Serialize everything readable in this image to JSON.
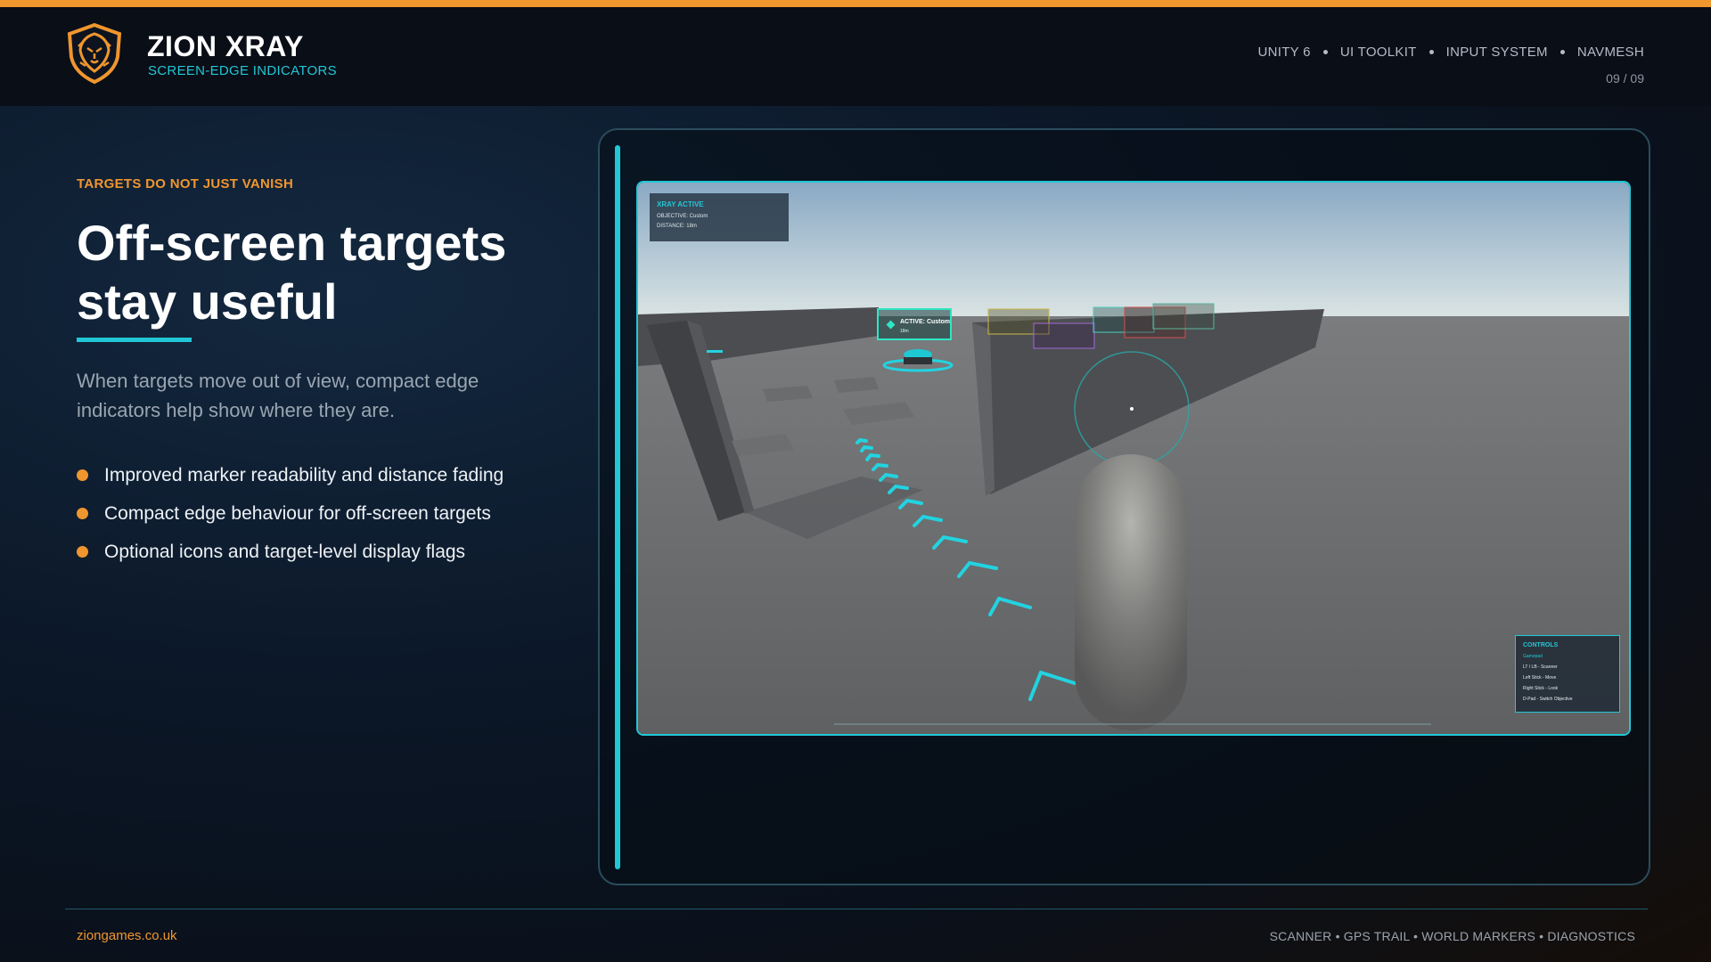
{
  "header": {
    "brand_title": "ZION XRAY",
    "brand_subtitle": "SCREEN-EDGE INDICATORS",
    "tech_tags": [
      "UNITY 6",
      "UI TOOLKIT",
      "INPUT SYSTEM",
      "NAVMESH"
    ],
    "page_number": "09 / 09",
    "logo_icon": "lion-shield-icon"
  },
  "content": {
    "eyebrow": "TARGETS DO NOT JUST VANISH",
    "headline_line1": "Off-screen targets",
    "headline_line2": "stay useful",
    "lead": "When targets move out of view, compact edge indicators help show where they are.",
    "bullets": [
      "Improved marker readability and distance fading",
      "Compact edge behaviour for off-screen targets",
      "Optional icons and target-level display flags"
    ]
  },
  "game": {
    "hud": {
      "title": "XRAY ACTIVE",
      "objective": "OBJECTIVE: Custom",
      "distance": "DISTANCE: 18m"
    },
    "active_marker": {
      "label": "ACTIVE: Custom",
      "distance": "18m"
    },
    "controls": {
      "title": "CONTROLS",
      "subtitle": "Gamepad",
      "lines": [
        "LT / LB - Scanner",
        "Left Stick - Move",
        "Right Stick - Look",
        "D-Pad - Switch Objective"
      ]
    }
  },
  "footer": {
    "website": "ziongames.co.uk",
    "features": "SCANNER • GPS TRAIL • WORLD MARKERS • DIAGNOSTICS"
  },
  "colors": {
    "accent_orange": "#f0962e",
    "accent_cyan": "#22c7d6",
    "background": "#0b1626"
  }
}
